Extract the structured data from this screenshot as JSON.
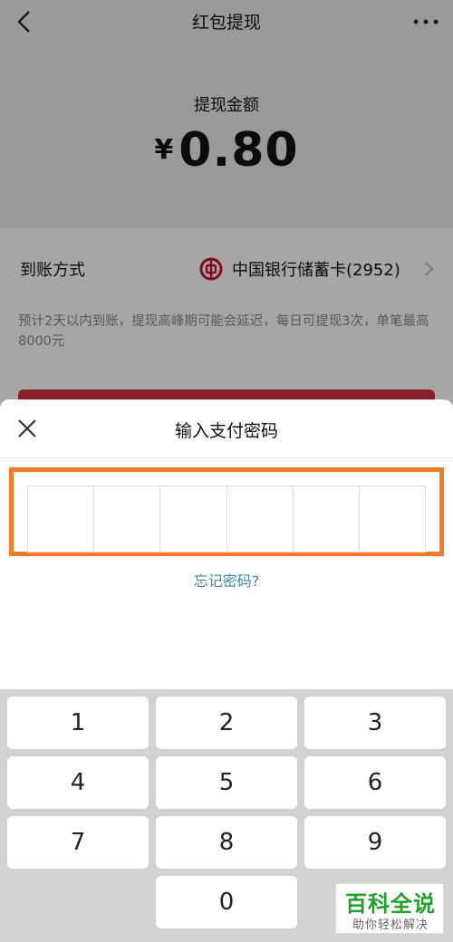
{
  "nav": {
    "title": "红包提现",
    "back_icon": "chevron-left-icon",
    "more_icon": "more-dots-icon"
  },
  "withdraw": {
    "amount_label": "提现金额",
    "currency_symbol": "¥",
    "amount": "0.80"
  },
  "payout_method": {
    "label": "到账方式",
    "bank_icon": "bank-of-china-logo",
    "bank_name": "中国银行储蓄卡(2952)"
  },
  "notice": "预计2天以内到账，提现高峰期可能会延迟，每日可提现3次，单笔最高8000元",
  "password_sheet": {
    "title": "输入支付密码",
    "close_icon": "close-icon",
    "pin_digits_entered": 0,
    "pin_length": 6,
    "forgot_link": "忘记密码?",
    "highlight_color": "#f57c26"
  },
  "keypad": {
    "keys": [
      "1",
      "2",
      "3",
      "4",
      "5",
      "6",
      "7",
      "8",
      "9",
      "0"
    ]
  },
  "watermark": {
    "title": "百科全说",
    "subtitle": "助你轻松解决"
  },
  "colors": {
    "accent_button": "#d6303f",
    "link": "#3a87a7",
    "watermark_green": "#22a02a"
  }
}
